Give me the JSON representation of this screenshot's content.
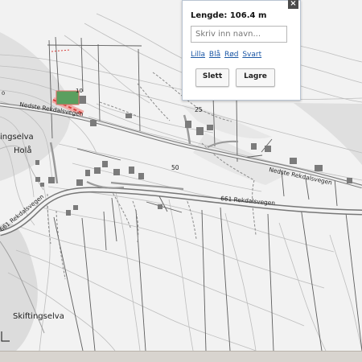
{
  "measurement": {
    "length": "Lengde: 106.4 m",
    "name_placeholder": "Skriv inn navn...",
    "colors": [
      "Lilla",
      "Blå",
      "Rød",
      "Svart"
    ],
    "delete_button": "Slett",
    "save_button": "Lagre",
    "close_label": "×"
  },
  "map": {
    "place_labels": {
      "ingselva": "ingselva",
      "hola": "Holå",
      "skiftingselva": "Skiftingselva"
    },
    "road_labels": {
      "nedste_left": "Nedste Rekdalsvegen",
      "nedste_right": "Nedste Rekdalsvegen",
      "road661_left": "661 Rekdalsvegen",
      "road661_right": "661 Rekdalsvegen"
    },
    "contours": {
      "c0": "0",
      "c25": "25",
      "c50": "50",
      "c10": "10"
    }
  }
}
